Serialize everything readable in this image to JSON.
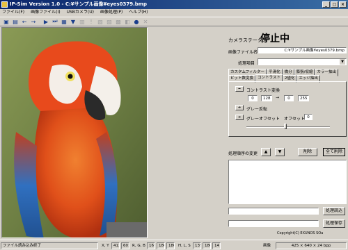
{
  "window": {
    "title": "IP-Sim Version 1.0  -  C:¥サンプル画像¥eyes0379.bmp",
    "minimize": "_",
    "maximize": "□",
    "close": "×"
  },
  "menu": [
    "ファイル(F)",
    "画像ファイル(I)",
    "USBカメラ(U)",
    "画像処理(P)",
    "ヘルプ(H)"
  ],
  "toolbar_icons": [
    "open-folder-icon",
    "save-icon",
    "back-arrow-icon",
    "forward-arrow-icon",
    "play-icon",
    "next-icon",
    "grid-icon",
    "filter-icon",
    "color-icon",
    "sample-icon",
    "tool-icon",
    "copy-icon",
    "paste-icon",
    "camera-icon",
    "record-icon",
    "info-icon"
  ],
  "status": {
    "label": "カメラステータス",
    "value": "停止中"
  },
  "file": {
    "label": "画像ファイル名",
    "value": "C:¥サンプル画像¥eyes0379.bmp"
  },
  "process": {
    "label": "処理項目",
    "value": ""
  },
  "tabs_row1": [
    "カスタムフィルター",
    "平滑化",
    "微分",
    "膨張/収縮",
    "カラー抽出"
  ],
  "tabs_row2": [
    "ビット数変換",
    "コントラスト",
    "2値化",
    "エッジ抽出"
  ],
  "contrast": {
    "label": "コントラスト変換",
    "in_low": "0",
    "in_high": "128",
    "arrow": "→",
    "out_low": "0",
    "out_high": "255",
    "gray_invert": "グレー反転",
    "gray_offset": "グレーオフセット",
    "offset_label": "オフセット",
    "offset_value": "0"
  },
  "order": {
    "label": "処理順序の変更",
    "up": "▲",
    "down": "▼",
    "delete": "削除",
    "delete_all": "全て削除"
  },
  "buttons": {
    "process_read": "処理読込",
    "process_save": "処理保存"
  },
  "copyright": "Copyright(C) EXUNOS SOa",
  "statusbar": {
    "message": "ファイル読み込み終了",
    "xy_label": "X, Y",
    "x": "413",
    "y": "601",
    "rgb_label": "R, G, B",
    "r": "167",
    "g": "186",
    "b": "180",
    "hls_label": "H, L, S",
    "h": "139",
    "l": "180",
    "s": "14",
    "img_label": "画像",
    "img_value": "425 × 640 × 24 bpp"
  }
}
